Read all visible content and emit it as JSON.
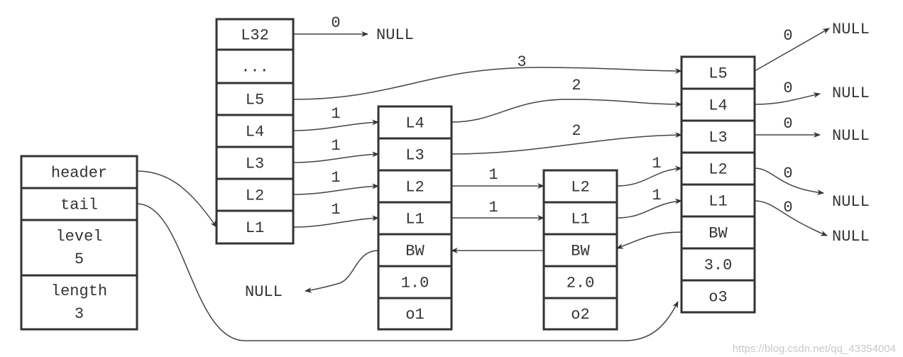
{
  "list_struct": {
    "rows": [
      "header",
      "tail",
      "level\n5",
      "length\n3"
    ]
  },
  "header_node": {
    "rows": [
      "L32",
      "...",
      "L5",
      "L4",
      "L3",
      "L2",
      "L1"
    ]
  },
  "node1": {
    "rows": [
      "L4",
      "L3",
      "L2",
      "L1",
      "BW",
      "1.0",
      "o1"
    ]
  },
  "node2": {
    "rows": [
      "L2",
      "L1",
      "BW",
      "2.0",
      "o2"
    ]
  },
  "node3": {
    "rows": [
      "L5",
      "L4",
      "L3",
      "L2",
      "L1",
      "BW",
      "3.0",
      "o3"
    ]
  },
  "null_label": "NULL",
  "edges": {
    "h_l32": "0",
    "h_l5": "3",
    "h_l4": "1",
    "h_l3": "1",
    "h_l2": "1",
    "h_l1": "1",
    "n1_l4": "2",
    "n1_l3": "2",
    "n1_l2": "1",
    "n1_l1": "1",
    "n2_l2": "1",
    "n2_l1": "1",
    "n3_l5": "0",
    "n3_l4": "0",
    "n3_l3": "0",
    "n3_l2": "0",
    "n3_l1": "0"
  },
  "watermark": "https://blog.csdn.net/qq_43354004"
}
